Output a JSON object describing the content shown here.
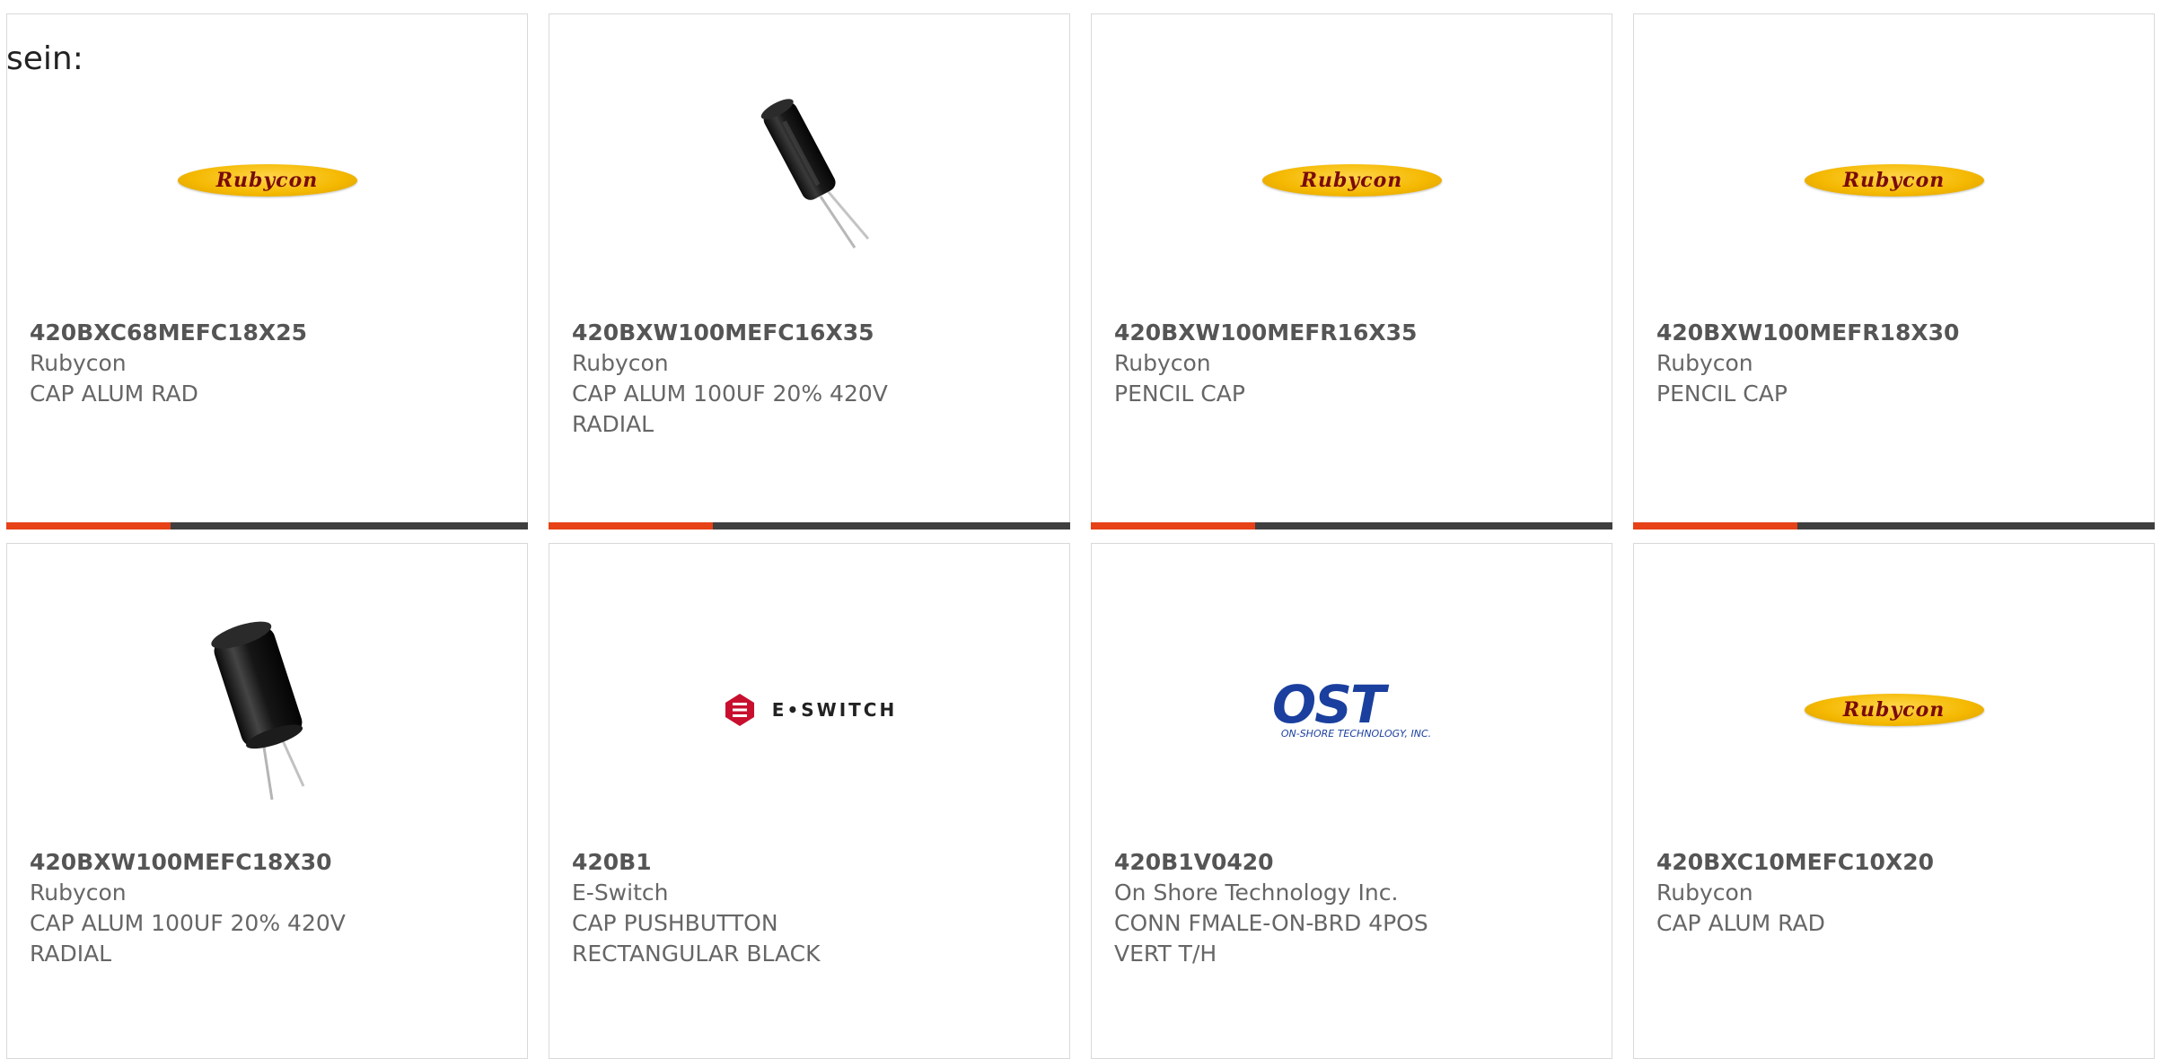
{
  "intro_text": "sein:",
  "colors": {
    "accent": "#e64117",
    "bar": "#3f3f3f",
    "rubycon_yellow": "#f4b800",
    "eswitch_red": "#c8102e",
    "ost_blue": "#1a3f9e"
  },
  "products": [
    {
      "part_number": "420BXC68MEFC18X25",
      "manufacturer": "Rubycon",
      "description": "CAP ALUM RAD",
      "image": "rubycon-logo",
      "logo_text": "Rubycon"
    },
    {
      "part_number": "420BXW100MEFC16X35",
      "manufacturer": "Rubycon",
      "description": "CAP ALUM 100UF 20% 420V\nRADIAL",
      "image": "capacitor-photo-slim"
    },
    {
      "part_number": "420BXW100MEFR16X35",
      "manufacturer": "Rubycon",
      "description": "PENCIL CAP",
      "image": "rubycon-logo",
      "logo_text": "Rubycon"
    },
    {
      "part_number": "420BXW100MEFR18X30",
      "manufacturer": "Rubycon",
      "description": "PENCIL CAP",
      "image": "rubycon-logo",
      "logo_text": "Rubycon"
    },
    {
      "part_number": "420BXW100MEFC18X30",
      "manufacturer": "Rubycon",
      "description": "CAP ALUM 100UF 20% 420V\nRADIAL",
      "image": "capacitor-photo-wide"
    },
    {
      "part_number": "420B1",
      "manufacturer": "E-Switch",
      "description": "CAP PUSHBUTTON\nRECTANGULAR BLACK",
      "image": "eswitch-logo",
      "logo_text": "E•SWITCH"
    },
    {
      "part_number": "420B1V0420",
      "manufacturer": "On Shore Technology Inc.",
      "description": "CONN FMALE-ON-BRD 4POS\nVERT T/H",
      "image": "ost-logo",
      "logo_text": "OST",
      "logo_subtext": "ON-SHORE TECHNOLOGY, INC."
    },
    {
      "part_number": "420BXC10MEFC10X20",
      "manufacturer": "Rubycon",
      "description": "CAP ALUM RAD",
      "image": "rubycon-logo",
      "logo_text": "Rubycon"
    }
  ]
}
